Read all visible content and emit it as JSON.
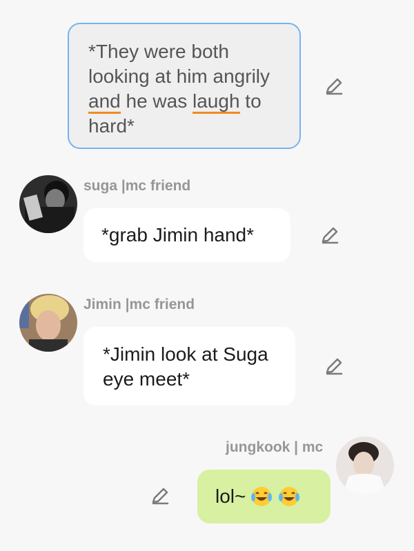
{
  "messages": [
    {
      "text_parts": [
        "*They were both looking at him angrily",
        "and",
        " he was ",
        "laugh",
        " to hard*"
      ]
    },
    {
      "sender": "suga |mc friend",
      "text": "*grab Jimin hand*"
    },
    {
      "sender": "Jimin |mc friend",
      "text": "*Jimin look at Suga eye meet*"
    },
    {
      "sender": "jungkook | mc",
      "text": "lol~"
    }
  ],
  "colors": {
    "accent_border": "#75b3ef",
    "underline": "#f28a1f",
    "mine_bubble": "#d7f0a1"
  },
  "icons": [
    "edit-pencil-icon",
    "avatar-suga",
    "avatar-jimin",
    "avatar-jungkook",
    "laughing-tears-emoji"
  ]
}
